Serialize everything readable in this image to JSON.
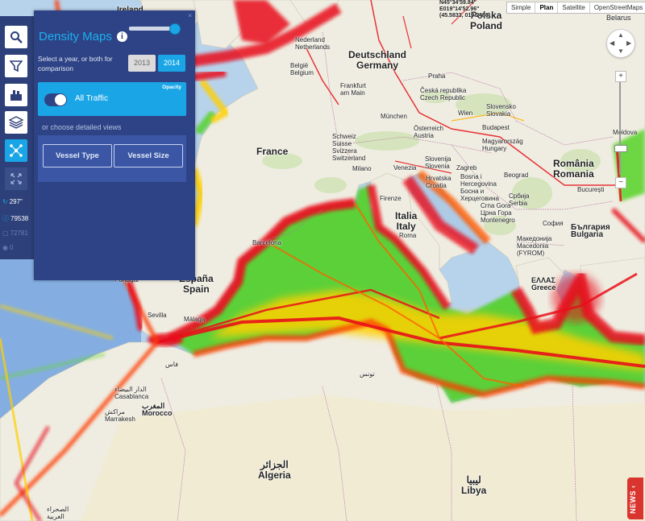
{
  "map": {
    "coordinates": {
      "lat": "N45°34'59.84\"",
      "lon": "E019°14'52.96\"",
      "decimal": "(45.5833, 019.2480)"
    },
    "map_types": [
      {
        "label": "Simple",
        "active": false
      },
      {
        "label": "Plan",
        "active": true
      },
      {
        "label": "Satellite",
        "active": false
      },
      {
        "label": "OpenStreetMaps",
        "active": false
      }
    ],
    "zoom_in": "+",
    "zoom_out": "−",
    "news_label": "NEWS ‹",
    "country_labels": [
      {
        "text": "Polska",
        "sub": "Poland"
      },
      {
        "text": "Deutschland",
        "sub": "Germany"
      },
      {
        "text": "France",
        "sub": ""
      },
      {
        "text": "Italia",
        "sub": "Italy"
      },
      {
        "text": "România",
        "sub": "Romania"
      },
      {
        "text": "Algeria",
        "sub": ""
      },
      {
        "text": "Libya",
        "sub": ""
      },
      {
        "text": "España",
        "sub": "Spain"
      },
      {
        "text": "Belarus",
        "sub": ""
      },
      {
        "text": "Ireland",
        "sub": ""
      }
    ],
    "algeria_arabic": "الجزائر",
    "libya_arabic": "ليبيا",
    "city_labels": {
      "nederland": "Nederland",
      "netherlands": "Netherlands",
      "belgie": "België",
      "belgium": "Belgium",
      "frankfurt": "Frankfurt",
      "frankfurt2": "am Main",
      "praha": "Praha",
      "ceska": "Česká republika",
      "czech": "Czech Republic",
      "slovensko": "Slovensko",
      "slovakia": "Slovakia",
      "munchen": "München",
      "osterreich": "Österreich",
      "austria": "Austria",
      "wien": "Wien",
      "budapest": "Budapest",
      "magyar": "Magyarország",
      "hungary": "Hungary",
      "schweiz": "Schweiz",
      "suisse": "Suisse",
      "svizzera": "Svizzera",
      "switzerland": "Switzerland",
      "milano": "Milano",
      "venezia": "Venezia",
      "slovenija": "Slovenija",
      "slovenia": "Slovenia",
      "zagreb": "Zagreb",
      "hrvatska": "Hrvatska",
      "croatia": "Croatia",
      "bosna": "Bosna i",
      "hercegovina": "Hercegovina",
      "bosna_cyr": "Босна и",
      "herceg_cyr": "Херцеговина",
      "crna": "Crna Gora",
      "crna_cyr": "Црна Гора",
      "montenegro": "Montenegro",
      "srbija": "Србија",
      "serbia": "Serbia",
      "beograd": "Beograd",
      "moldova": "Moldova",
      "bucuresti": "București",
      "sofia": "София",
      "bulgaria_cyr": "България",
      "bulgaria": "Bulgaria",
      "makedonija": "Македонија",
      "macedonia": "Macedonia",
      "fyrom": "(FYROM)",
      "ellas": "ΕΛΛΑΣ",
      "greece": "Greece",
      "firenze": "Firenze",
      "roma": "Roma",
      "barcelona": "Barcelona",
      "sevilla": "Sevilla",
      "malaga": "Málaga",
      "casablanca": "Casablanca",
      "casablanca_ar": "الدار البيضاء",
      "morocco_ar": "المغرب",
      "morocco": "Morocco",
      "marrakesh": "Marrakesh",
      "marrakesh_ar": "مراكش",
      "tunisia_ar": "تونس",
      "fes": "فاس",
      "portugal": "Portugal",
      "sahara_ar": "الصحراء",
      "sahara_ar2": "الغربية"
    }
  },
  "toolbar": {
    "buttons": [
      {
        "icon": "search-icon"
      },
      {
        "icon": "filter-icon"
      },
      {
        "icon": "fleet-icon"
      },
      {
        "icon": "layers-icon"
      },
      {
        "icon": "density-icon",
        "active": true
      },
      {
        "icon": "fullscreen-icon"
      }
    ],
    "stats": [
      {
        "icon": "refresh-icon",
        "value": "297\""
      },
      {
        "icon": "info-icon",
        "value": "79538"
      },
      {
        "icon": "square-icon",
        "value": "72781"
      },
      {
        "icon": "dot-icon",
        "value": "0"
      }
    ]
  },
  "density_panel": {
    "title": "Density Maps",
    "close": "×",
    "year_prompt": "Select a year, or both for comparison",
    "years": [
      {
        "label": "2013",
        "selected": false
      },
      {
        "label": "2014",
        "selected": true
      }
    ],
    "traffic_label": "All Traffic",
    "opacity_label": "Opacity",
    "opacity_value": 0.95,
    "detail_prompt": "or choose detailed views",
    "views": [
      {
        "label": "Vessel Type"
      },
      {
        "label": "Vessel Size"
      }
    ]
  },
  "colors": {
    "panel_bg": "#2e4385",
    "accent": "#1aa6e6",
    "density_high": "#e8101a",
    "density_mid": "#ffb000",
    "density_low": "#4ed21a",
    "sea": "#b7d3ec",
    "land": "#f0eee4"
  }
}
